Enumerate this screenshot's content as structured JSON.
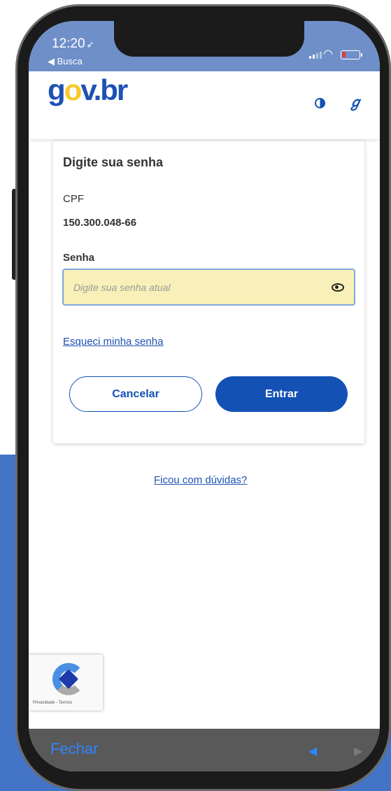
{
  "status_bar": {
    "time": "12:20",
    "location_icon": "location-arrow-icon",
    "back_app": "◀ Busca"
  },
  "header": {
    "logo_text": "gov.br",
    "contrast_icon": "contrast-icon",
    "accessibility_icon": "hearing-accessibility-icon"
  },
  "login": {
    "title": "Digite sua senha",
    "cpf_label": "CPF",
    "cpf_value": "150.300.048-66",
    "password_label": "Senha",
    "password_placeholder": "Digite sua senha atual",
    "password_value": "",
    "forgot_link": "Esqueci minha senha",
    "cancel_button": "Cancelar",
    "submit_button": "Entrar"
  },
  "help_link": "Ficou com dúvidas?",
  "recaptcha": {
    "footer_text": "Privacidade - Termos"
  },
  "toolbar": {
    "close_label": "Fechar",
    "back_icon": "triangle-left-icon",
    "forward_icon": "triangle-right-icon"
  },
  "colors": {
    "brand_blue": "#1451b4",
    "status_bar": "#6f8fc9",
    "input_autofill": "#f8f0b8",
    "page_background_blue": "#4474c6"
  }
}
